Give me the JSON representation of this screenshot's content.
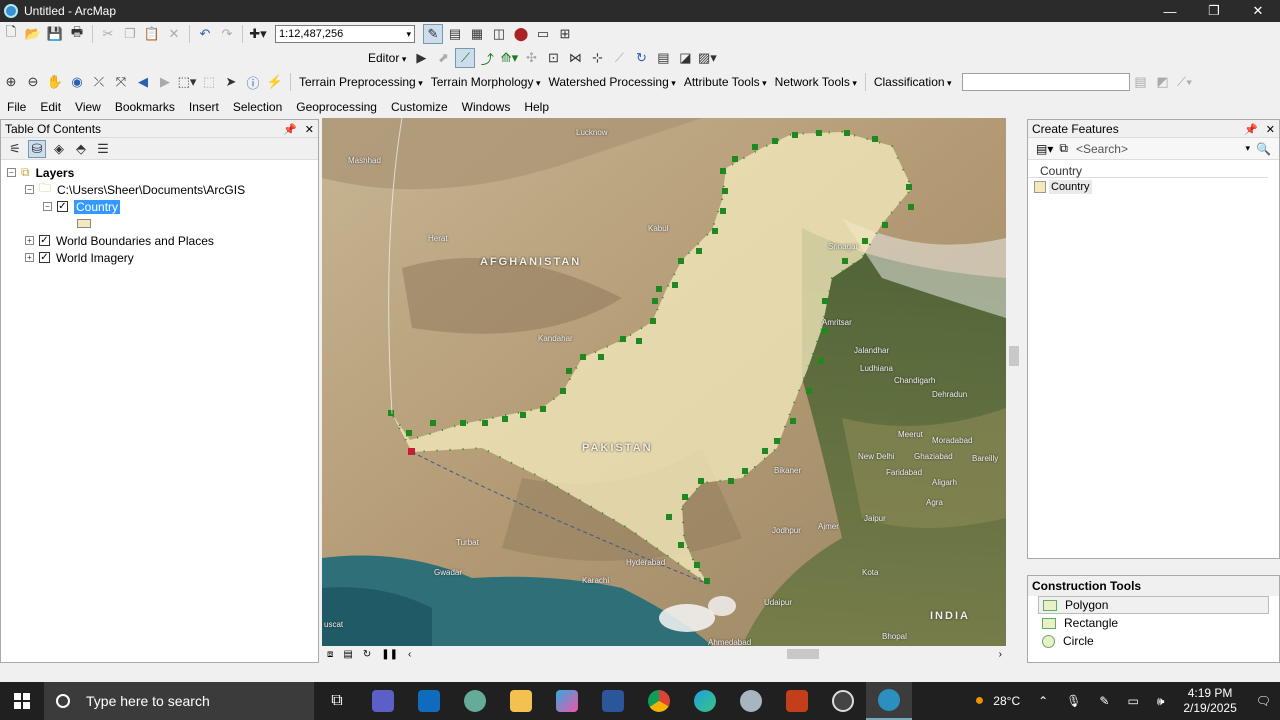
{
  "window": {
    "title": "Untitled - ArcMap",
    "min": "—",
    "max": "❐",
    "close": "✕"
  },
  "toolbar": {
    "scale": "1:12,487,256",
    "editor": "Editor",
    "menus": [
      "Terrain Preprocessing",
      "Terrain Morphology",
      "Watershed Processing",
      "Attribute Tools",
      "Network Tools"
    ],
    "classification": "Classification"
  },
  "menubar": [
    "File",
    "Edit",
    "View",
    "Bookmarks",
    "Insert",
    "Selection",
    "Geoprocessing",
    "Customize",
    "Windows",
    "Help"
  ],
  "toc": {
    "title": "Table Of Contents",
    "layers_root": "Layers",
    "folder": "C:\\Users\\Sheer\\Documents\\ArcGIS",
    "layer_country": "Country",
    "layer_boundaries": "World Boundaries and Places",
    "layer_imagery": "World Imagery"
  },
  "map": {
    "labels": {
      "afghanistan": "AFGHANISTAN",
      "pakistan": "PAKISTAN",
      "india": "INDIA",
      "kabul": "Kabul",
      "herat": "Herat",
      "mashhad": "Mashhad",
      "kandahar": "Kandahar",
      "new_delhi": "New Delhi",
      "ghaziabad": "Ghaziabad",
      "jaipur": "Jaipur",
      "karachi": "Karachi",
      "ahmedabad": "Ahmedabad",
      "bhopal": "Bhopal",
      "ludhiana": "Ludhiana",
      "jalandhar": "Jalandhar",
      "dehradun": "Dehradun",
      "srinagar": "Srinagar",
      "faridabad": "Faridabad",
      "agra": "Agra",
      "bikaner": "Bikaner",
      "jodhpur": "Jodhpur",
      "kota": "Kota",
      "udaipur": "Udaipur",
      "turbat": "Turbat",
      "gwadar": "Gwadar",
      "muscat": "uscat",
      "meerut": "Meerut",
      "moradabad": "Moradabad",
      "bareilly": "Bareilly",
      "aligarh": "Aligarh",
      "chandigarh": "Chandigarh",
      "hyderabad": "Hyderabad",
      "ajmer": "Ajmer",
      "lucknow": "Lucknow",
      "amritsar": "Amritsar"
    }
  },
  "create_features": {
    "title": "Create Features",
    "search_placeholder": "<Search>",
    "group": "Country",
    "item": "Country"
  },
  "construction_tools": {
    "title": "Construction Tools",
    "items": [
      "Polygon",
      "Rectangle",
      "Circle"
    ]
  },
  "taskbar": {
    "search_text": "Type here to search",
    "temperature": "28°C",
    "time": "4:19 PM",
    "date": "2/19/2025"
  },
  "colors": {
    "taskbar": "#202020",
    "selection": "#3399ff",
    "polygon_fill": "#f4e9bd",
    "vertex": "#1e8a1e"
  }
}
